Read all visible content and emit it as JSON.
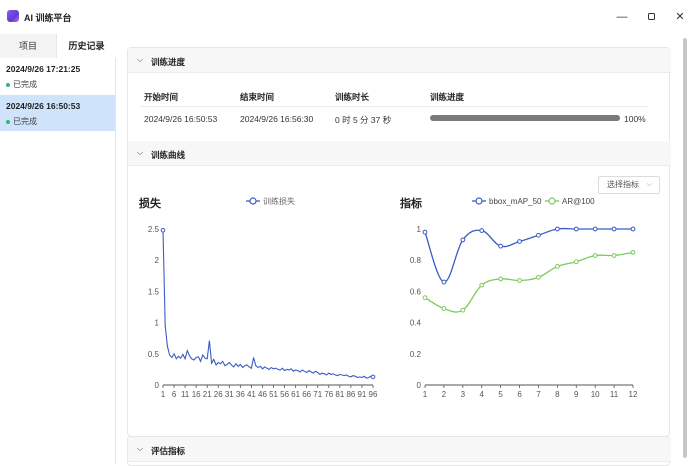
{
  "app": {
    "title": "AI 训练平台",
    "window_controls": [
      "minimize",
      "maximize",
      "close"
    ]
  },
  "sidebar": {
    "tabs": [
      {
        "label": "项目",
        "selected": false
      },
      {
        "label": "历史记录",
        "selected": true
      }
    ],
    "history": [
      {
        "date": "2024/9/26 17:21:25",
        "status": "已完成",
        "selected": false
      },
      {
        "date": "2024/9/26 16:50:53",
        "status": "已完成",
        "selected": true
      }
    ]
  },
  "sections": {
    "progress": "训练进度",
    "curves": "训练曲线",
    "eval": "评估指标"
  },
  "progress_table": {
    "headers": [
      "开始时间",
      "结束时间",
      "训练时长",
      "训练进度"
    ],
    "row": {
      "start": "2024/9/26 16:50:53",
      "end": "2024/9/26 16:56:30",
      "duration": "0 时 5 分 37 秒",
      "progress": 100,
      "progress_label": "100%"
    }
  },
  "metric_selector": {
    "label": "选择指标"
  },
  "colors": {
    "blue": "#3b5cc5",
    "green": "#7ccb5a",
    "selected_bg": "#cfe3fb"
  },
  "chart_data": [
    {
      "type": "line",
      "title": "损失",
      "legend_position": "top",
      "ylim": [
        0,
        2.5
      ],
      "yticks": [
        0,
        0.5,
        1,
        1.5,
        2,
        2.5
      ],
      "xticks": [
        1,
        6,
        11,
        16,
        21,
        26,
        31,
        36,
        41,
        46,
        51,
        56,
        61,
        66,
        71,
        76,
        81,
        86,
        91,
        96
      ],
      "series": [
        {
          "name": "训练损失",
          "color": "#3b5cc5",
          "x": [
            1,
            2,
            3,
            4,
            5,
            6,
            7,
            8,
            9,
            10,
            11,
            12,
            13,
            14,
            15,
            16,
            17,
            18,
            19,
            20,
            21,
            22,
            23,
            24,
            25,
            26,
            27,
            28,
            29,
            30,
            31,
            32,
            33,
            34,
            35,
            36,
            37,
            38,
            39,
            40,
            41,
            42,
            43,
            44,
            45,
            46,
            47,
            48,
            49,
            50,
            51,
            52,
            53,
            54,
            55,
            56,
            57,
            58,
            59,
            60,
            61,
            62,
            63,
            64,
            65,
            66,
            67,
            68,
            69,
            70,
            71,
            72,
            73,
            74,
            75,
            76,
            77,
            78,
            79,
            80,
            81,
            82,
            83,
            84,
            85,
            86,
            87,
            88,
            89,
            90,
            91,
            92,
            93,
            94,
            95,
            96
          ],
          "values": [
            2.48,
            0.95,
            0.62,
            0.48,
            0.44,
            0.5,
            0.42,
            0.46,
            0.43,
            0.49,
            0.42,
            0.55,
            0.47,
            0.42,
            0.4,
            0.44,
            0.45,
            0.38,
            0.48,
            0.43,
            0.42,
            0.71,
            0.35,
            0.41,
            0.32,
            0.36,
            0.34,
            0.38,
            0.31,
            0.33,
            0.36,
            0.32,
            0.29,
            0.34,
            0.3,
            0.33,
            0.28,
            0.31,
            0.32,
            0.29,
            0.27,
            0.44,
            0.31,
            0.28,
            0.3,
            0.26,
            0.29,
            0.27,
            0.25,
            0.28,
            0.26,
            0.27,
            0.25,
            0.24,
            0.27,
            0.23,
            0.25,
            0.24,
            0.26,
            0.22,
            0.24,
            0.23,
            0.21,
            0.24,
            0.22,
            0.2,
            0.23,
            0.21,
            0.19,
            0.22,
            0.2,
            0.17,
            0.19,
            0.18,
            0.16,
            0.19,
            0.17,
            0.18,
            0.16,
            0.15,
            0.17,
            0.16,
            0.15,
            0.16,
            0.14,
            0.13,
            0.15,
            0.14,
            0.12,
            0.13,
            0.12,
            0.14,
            0.11,
            0.12,
            0.14,
            0.13
          ]
        }
      ]
    },
    {
      "type": "line",
      "title": "指标",
      "legend_position": "top",
      "ylim": [
        0,
        1
      ],
      "yticks": [
        0,
        0.2,
        0.4,
        0.6,
        0.8,
        1
      ],
      "categories": [
        1,
        2,
        3,
        4,
        5,
        6,
        7,
        8,
        9,
        10,
        11,
        12
      ],
      "series": [
        {
          "name": "bbox_mAP_50",
          "color": "#3b5cc5",
          "values": [
            0.98,
            0.66,
            0.93,
            0.99,
            0.89,
            0.92,
            0.96,
            1.0,
            1.0,
            1.0,
            1.0,
            1.0
          ]
        },
        {
          "name": "AR@100",
          "color": "#7ccb5a",
          "values": [
            0.56,
            0.49,
            0.48,
            0.64,
            0.68,
            0.67,
            0.69,
            0.76,
            0.79,
            0.83,
            0.83,
            0.85
          ]
        }
      ]
    }
  ]
}
